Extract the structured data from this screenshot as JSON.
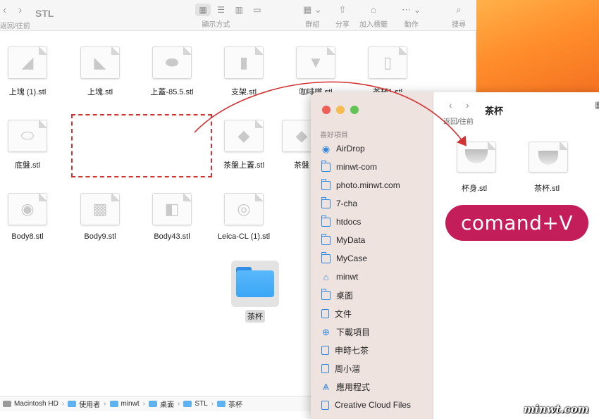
{
  "back_window": {
    "title": "STL",
    "back_forward_label": "返回/往前",
    "toolbar": [
      {
        "label": "顯示方式",
        "icon": "view-mode-icon"
      },
      {
        "label": "群組",
        "icon": "group-icon"
      },
      {
        "label": "分享",
        "icon": "share-icon"
      },
      {
        "label": "加入標籤",
        "icon": "tag-icon"
      },
      {
        "label": "動作",
        "icon": "action-icon"
      },
      {
        "label": "搜尋",
        "icon": "search-icon"
      }
    ],
    "files": [
      {
        "name": "上塊 (1).stl"
      },
      {
        "name": "上塊.stl"
      },
      {
        "name": "上蓋-85.5.stl"
      },
      {
        "name": "支架.stl"
      },
      {
        "name": "咖啡嘴.stl"
      },
      {
        "name": "茶杯1.stl"
      },
      {
        "name": "底盤.stl"
      },
      {
        "name": "茶盤上蓋.stl"
      },
      {
        "name": "茶盤"
      },
      {
        "name": "Body8.stl"
      },
      {
        "name": "Body9.stl"
      },
      {
        "name": "Body43.stl"
      },
      {
        "name": "Leica-CL (1).stl"
      }
    ],
    "folder": {
      "name": "茶杯"
    },
    "path": [
      "Macintosh HD",
      "使用者",
      "minwt",
      "桌面",
      "STL",
      "茶杯"
    ]
  },
  "front_window": {
    "title": "茶杯",
    "back_forward_label": "返回/往前",
    "sidebar": {
      "section": "喜好項目",
      "items": [
        {
          "label": "AirDrop",
          "icon": "airdrop-icon"
        },
        {
          "label": "minwt-com",
          "icon": "folder-icon"
        },
        {
          "label": "photo.minwt.com",
          "icon": "folder-icon"
        },
        {
          "label": "7-cha",
          "icon": "folder-icon"
        },
        {
          "label": "htdocs",
          "icon": "folder-icon"
        },
        {
          "label": "MyData",
          "icon": "folder-icon"
        },
        {
          "label": "MyCase",
          "icon": "folder-icon"
        },
        {
          "label": "minwt",
          "icon": "home-icon"
        },
        {
          "label": "桌面",
          "icon": "folder-icon"
        },
        {
          "label": "文件",
          "icon": "document-icon"
        },
        {
          "label": "下載項目",
          "icon": "download-icon"
        },
        {
          "label": "申時七茶",
          "icon": "document-icon"
        },
        {
          "label": "周小溜",
          "icon": "document-icon"
        },
        {
          "label": "應用程式",
          "icon": "applications-icon"
        },
        {
          "label": "Creative Cloud Files",
          "icon": "document-icon"
        }
      ]
    },
    "files": [
      {
        "name": "杯身.stl"
      },
      {
        "name": "茶杯.stl"
      }
    ]
  },
  "annotation": {
    "text": "comand+V",
    "color": "#c41e5a"
  },
  "arrow_color": "#d23232",
  "watermark": "minwt.com"
}
